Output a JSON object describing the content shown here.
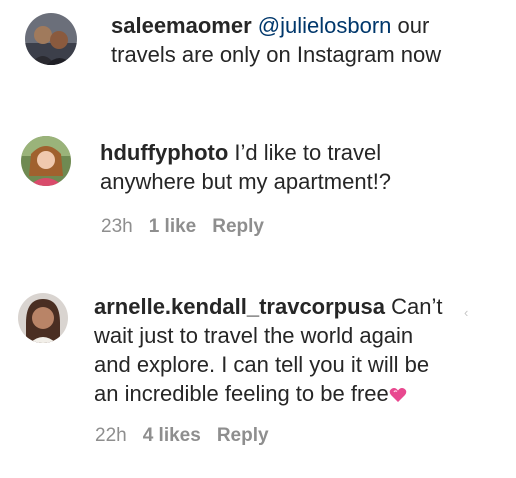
{
  "comments": [
    {
      "username": "saleemaomer",
      "mention": "@julielosborn",
      "text_line1_rest": " our",
      "text_line2": "travels are only on Instagram now"
    },
    {
      "username": "hduffyphoto",
      "text_line1_rest": " I’d like to travel",
      "text_line2": "anywhere but my apartment!?",
      "time": "23h",
      "likes": "1 like",
      "reply": "Reply"
    },
    {
      "username": "arnelle.kendall_travcorpusa",
      "text_line1_rest": " Can’t",
      "text_line2": "wait just to travel the world again",
      "text_line3": "and explore. I can tell you it will be",
      "text_line4": "an incredible feeling to be free",
      "time": "22h",
      "likes": "4 likes",
      "reply": "Reply"
    }
  ],
  "icons": {
    "heart": "pink-heart-emoji",
    "chevron": "‹"
  },
  "colors": {
    "text": "#262626",
    "muted": "#8e8e8e",
    "mention": "#00376b",
    "heart": "#e8488f"
  }
}
